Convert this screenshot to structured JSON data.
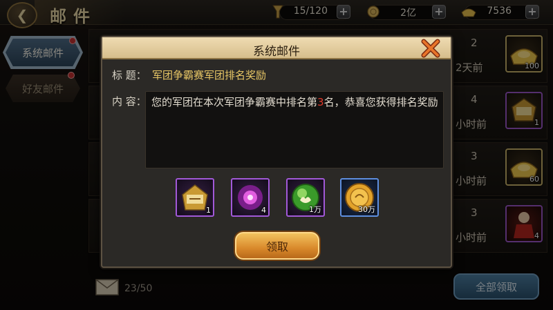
{
  "header": {
    "title": "邮件",
    "stamina": "15/120",
    "silver": "2亿",
    "gold": "7536",
    "plus": "+"
  },
  "tabs": [
    {
      "label": "系统邮件",
      "active": true
    },
    {
      "label": "好友邮件",
      "active": false
    }
  ],
  "mail_list": [
    {
      "count": "2",
      "time": "2天前",
      "item_count": "100"
    },
    {
      "count": "4",
      "time": "小时前",
      "item_count": "1"
    },
    {
      "count": "3",
      "time": "小时前",
      "item_count": "60"
    },
    {
      "count": "3",
      "time": "小时前",
      "item_count": "4"
    }
  ],
  "footer": {
    "mail_count": "23/50",
    "receive_all": "全部领取"
  },
  "dialog": {
    "title": "系统邮件",
    "subject_label": "标 题：",
    "subject": "军团争霸赛军团排名奖励",
    "content_label": "内 容：",
    "content_pre": "您的军团在本次军团争霸赛中排名第",
    "rank": "3",
    "content_post": "名，恭喜您获得排名奖励",
    "rewards": [
      {
        "icon": "title-badge-icon",
        "count": "1",
        "quality": "purple"
      },
      {
        "icon": "purple-orb-icon",
        "count": "4",
        "quality": "purple"
      },
      {
        "icon": "green-orb-icon",
        "count": "1万",
        "quality": "purple"
      },
      {
        "icon": "gold-coin-icon",
        "count": "30万",
        "quality": "blue"
      }
    ],
    "claim_label": "领取"
  },
  "colors": {
    "subject": "#e8c766",
    "rank": "#e23a2b",
    "claim_button": "#d9892b",
    "tab_active": "#4e6c86"
  }
}
